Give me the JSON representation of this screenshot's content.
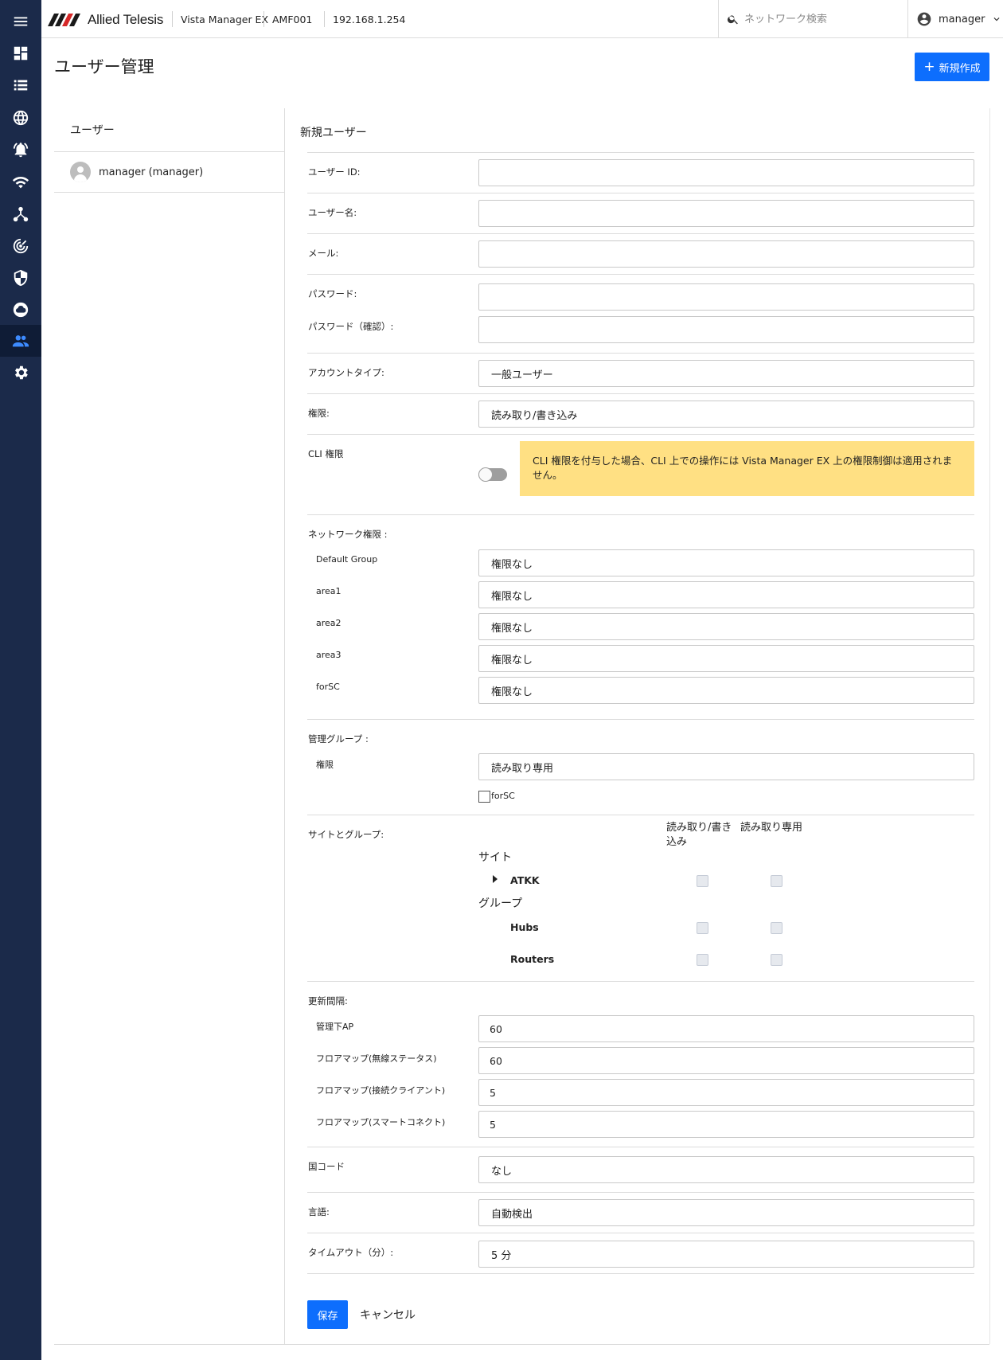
{
  "app": {
    "brand": "Allied Telesis",
    "product": "Vista Manager EX",
    "network": "AMF001",
    "address": "192.168.1.254"
  },
  "nav": {
    "items": [
      "menu-icon",
      "dashboard-icon",
      "list-icon",
      "globe-icon",
      "alarm-icon",
      "wifi-icon",
      "topology-icon",
      "radar-icon",
      "shield-icon",
      "cloud-icon",
      "people-icon",
      "gear-icon"
    ],
    "active": "people-icon"
  },
  "search": {
    "placeholder": "ネットワーク検索"
  },
  "user_menu": {
    "name": "manager"
  },
  "page": {
    "title": "ユーザー管理",
    "new_button": "新規作成",
    "new_button_icon": "+"
  },
  "users": {
    "heading": "ユーザー",
    "list": [
      "manager (manager)"
    ]
  },
  "form": {
    "title": "新規ユーザー",
    "user_id_label": "ユーザー ID:",
    "user_name_label": "ユーザー名:",
    "email_label": "メール:",
    "password_label": "パスワード:",
    "password_confirm_label": "パスワード（確認）:",
    "account_type_label": "アカウントタイプ:",
    "account_type_value": "一般ユーザー",
    "permission_label": "権限:",
    "permission_value": "読み取り/書き込み",
    "cli_label": "CLI 権限",
    "cli_enabled": false,
    "cli_notice": "CLI 権限を付与した場合、CLI 上での操作には Vista Manager EX 上の権限制御は適用されません。",
    "network_perm_label": "ネットワーク権限 :",
    "network_groups": [
      {
        "name": "Default Group",
        "value": "権限なし"
      },
      {
        "name": "area1",
        "value": "権限なし"
      },
      {
        "name": "area2",
        "value": "権限なし"
      },
      {
        "name": "area3",
        "value": "権限なし"
      },
      {
        "name": "forSC",
        "value": "権限なし"
      }
    ],
    "mgmt_group_label": "管理グループ :",
    "mgmt_perm_label": "権限",
    "mgmt_perm_value": "読み取り専用",
    "mgmt_checkbox_label": "forSC",
    "sites_groups_label": "サイトとグループ:",
    "col_rw": "読み取り/書き込み",
    "col_ro": "読み取り専用",
    "sites_heading": "サイト",
    "sites": [
      "ATKK"
    ],
    "groups_heading": "グループ",
    "groups": [
      "Hubs",
      "Routers"
    ],
    "refresh_label": "更新間隔:",
    "refresh": [
      {
        "name": "管理下AP",
        "value": "60"
      },
      {
        "name": "フロアマップ(無線ステータス)",
        "value": "60"
      },
      {
        "name": "フロアマップ(接続クライアント)",
        "value": "5"
      },
      {
        "name": "フロアマップ(スマートコネクト)",
        "value": "5"
      }
    ],
    "country_label": "国コード",
    "country_value": "なし",
    "language_label": "言語:",
    "language_value": "自動検出",
    "timeout_label": "タイムアウト（分）:",
    "timeout_value": "5 分",
    "save_button": "保存",
    "cancel_button": "キャンセル"
  },
  "colors": {
    "rail": "#1b2a4a",
    "accent": "#0d6efd",
    "notice": "#ffe083"
  }
}
